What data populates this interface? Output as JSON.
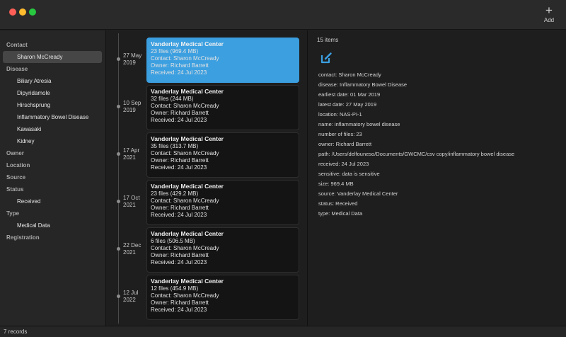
{
  "toolbar": {
    "add_label": "Add",
    "add_icon": "plus-icon"
  },
  "sidebar": {
    "sections": [
      {
        "header": "Contact",
        "items": [
          "Sharon McCready"
        ]
      },
      {
        "header": "Disease",
        "items": [
          "Biliary Atresia",
          "Dipyridamole",
          "Hirschsprung",
          "Inflammatory Bowel Disease",
          "Kawasaki",
          "Kidney"
        ]
      },
      {
        "header": "Owner",
        "items": []
      },
      {
        "header": "Location",
        "items": []
      },
      {
        "header": "Source",
        "items": []
      },
      {
        "header": "Status",
        "items": [
          "Received"
        ]
      },
      {
        "header": "Type",
        "items": [
          "Medical Data"
        ]
      },
      {
        "header": "Registration",
        "items": []
      }
    ],
    "selected_item": "Sharon McCready"
  },
  "timeline": [
    {
      "date_line1": "27 May",
      "date_line2": "2019",
      "title": "Vanderlay Medical Center",
      "files": "23 files (969.4 MB)",
      "contact": "Contact: Sharon McCready",
      "owner": "Owner: Richard Barrett",
      "received": "Received: 24 Jul 2023",
      "selected": true
    },
    {
      "date_line1": "10 Sep",
      "date_line2": "2019",
      "title": "Vanderlay Medical Center",
      "files": "32 files (244 MB)",
      "contact": "Contact: Sharon McCready",
      "owner": "Owner: Richard Barrett",
      "received": "Received: 24 Jul 2023",
      "selected": false
    },
    {
      "date_line1": "17 Apr",
      "date_line2": "2021",
      "title": "Vanderlay Medical Center",
      "files": "35 files (313.7 MB)",
      "contact": "Contact: Sharon McCready",
      "owner": "Owner: Richard Barrett",
      "received": "Received: 24 Jul 2023",
      "selected": false
    },
    {
      "date_line1": "17 Oct",
      "date_line2": "2021",
      "title": "Vanderlay Medical Center",
      "files": "23 files (429.2 MB)",
      "contact": "Contact: Sharon McCready",
      "owner": "Owner: Richard Barrett",
      "received": "Received: 24 Jul 2023",
      "selected": false
    },
    {
      "date_line1": "22 Dec",
      "date_line2": "2021",
      "title": "Vanderlay Medical Center",
      "files": "6 files (506.5 MB)",
      "contact": "Contact: Sharon McCready",
      "owner": "Owner: Richard Barrett",
      "received": "Received: 24 Jul 2023",
      "selected": false
    },
    {
      "date_line1": "12 Jul",
      "date_line2": "2022",
      "title": "Vanderlay Medical Center",
      "files": "12 files (454.9 MB)",
      "contact": "Contact: Sharon McCready",
      "owner": "Owner: Richard Barrett",
      "received": "Received: 24 Jul 2023",
      "selected": false
    }
  ],
  "detail": {
    "count": "15 items",
    "edit_icon": "edit-icon",
    "properties": [
      "contact: Sharon McCready",
      "disease: Inflammatory Bowel Disease",
      "earliest date: 01 Mar 2019",
      "latest date: 27 May 2019",
      "location: NAS-PI-1",
      "name: inflammatory bowel disease",
      "number of files: 23",
      "owner: Richard Barrett",
      "path: /Users/delfouneso/Documents/GWCMC/csv copy/inflammatory bowel disease",
      "received: 24 Jul 2023",
      "sensitive: data is sensitive",
      "size: 969.4 MB",
      "source: Vanderlay Medical Center",
      "status: Received",
      "type: Medical Data"
    ]
  },
  "status_bar": {
    "text": "7 records"
  },
  "colors": {
    "accent": "#3b9fe0",
    "edit_icon": "#3b9fe0"
  }
}
